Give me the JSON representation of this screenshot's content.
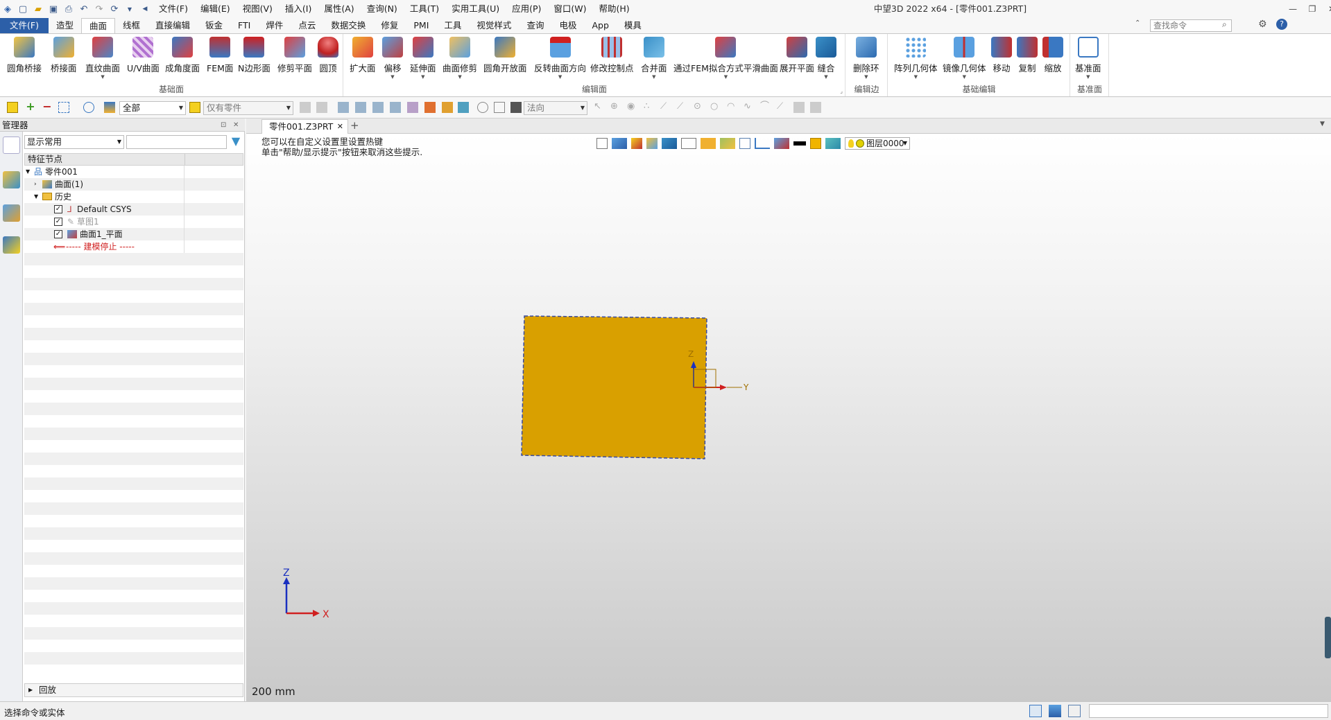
{
  "titlebar": {
    "menus": [
      "文件(F)",
      "编辑(E)",
      "视图(V)",
      "插入(I)",
      "属性(A)",
      "查询(N)",
      "工具(T)",
      "实用工具(U)",
      "应用(P)",
      "窗口(W)",
      "帮助(H)"
    ],
    "window_title": "中望3D 2022 x64 - [零件001.Z3PRT]",
    "search_placeholder": "查找命令"
  },
  "tabs": [
    "文件(F)",
    "造型",
    "曲面",
    "线框",
    "直接编辑",
    "钣金",
    "FTI",
    "焊件",
    "点云",
    "数据交换",
    "修复",
    "PMI",
    "工具",
    "视觉样式",
    "查询",
    "电极",
    "App",
    "模具"
  ],
  "active_tab": "曲面",
  "ribbon": {
    "groups": [
      {
        "title": "基础面",
        "buttons": [
          "圆角桥接",
          "桥接面",
          "直纹曲面",
          "U/V曲面",
          "成角度面",
          "FEM面",
          "N边形面",
          "修剪平面",
          "圆顶"
        ]
      },
      {
        "title": "编辑面",
        "buttons": [
          "扩大面",
          "偏移",
          "延伸面",
          "曲面修剪",
          "圆角开放面",
          "反转曲面方向",
          "修改控制点",
          "合并面",
          "通过FEM拟合方式平滑曲面",
          "展开平面",
          "缝合"
        ]
      },
      {
        "title": "编辑边",
        "buttons": [
          "删除环"
        ]
      },
      {
        "title": "基础编辑",
        "buttons": [
          "阵列几何体",
          "镜像几何体",
          "移动",
          "复制",
          "缩放"
        ]
      },
      {
        "title": "基准面",
        "buttons": [
          "基准面"
        ]
      }
    ]
  },
  "toolbar": {
    "filter_value": "全部",
    "scope_value": "仅有零件",
    "direction_value": "法向"
  },
  "manager": {
    "title": "管理器",
    "display_select": "显示常用",
    "column_header": "特征节点",
    "tree": [
      {
        "label": "零件001",
        "level": 0
      },
      {
        "label": "曲面(1)",
        "level": 1
      },
      {
        "label": "历史",
        "level": 1
      },
      {
        "label": "Default CSYS",
        "level": 2
      },
      {
        "label": "草图1",
        "level": 2
      },
      {
        "label": "曲面1_平面",
        "level": 2
      },
      {
        "label": "----- 建模停止 -----",
        "level": 2
      }
    ],
    "footer": "回放"
  },
  "document": {
    "tab": "零件001.Z3PRT",
    "hint_line1": "您可以在自定义设置里设置热键",
    "hint_line2": "单击\"帮助/显示提示\"按钮来取消这些提示.",
    "layer": "图层0000",
    "scale_label": "200 mm",
    "axis_z": "Z",
    "axis_x": "X",
    "axis_y": "Y",
    "surface_color": "#d9a000"
  },
  "status": {
    "text": "选择命令或实体"
  }
}
